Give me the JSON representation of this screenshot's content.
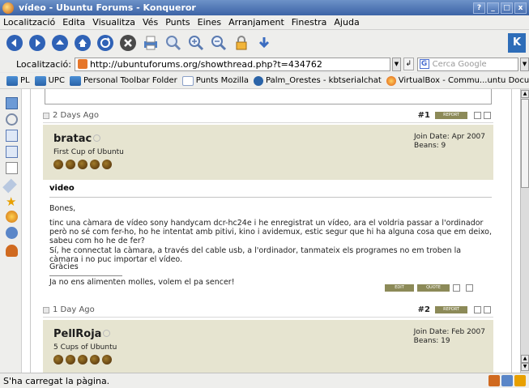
{
  "window": {
    "title": "vídeo - Ubuntu Forums - Konqueror",
    "buttons": [
      "?",
      "_",
      "□",
      "x"
    ]
  },
  "menubar": {
    "items": [
      "Localització",
      "Edita",
      "Visualitza",
      "Vés",
      "Punts",
      "Eines",
      "Arranjament",
      "Finestra",
      "Ajuda"
    ]
  },
  "toolbar": {
    "icons": [
      "back-icon",
      "forward-icon",
      "up-icon",
      "home-icon",
      "reload-icon",
      "stop-icon",
      "print-icon",
      "tools-icon",
      "zoom-in-icon",
      "zoom-out-icon",
      "lock-icon",
      "download-icon"
    ]
  },
  "location": {
    "label": "Localització:",
    "url": "http://ubuntuforums.org/showthread.php?t=434762",
    "search_placeholder": "Cerca Google"
  },
  "bookmarks": {
    "items": [
      "PL",
      "UPC",
      "Personal Toolbar Folder",
      "Punts Mozilla",
      "Palm_Orestes - kbtserialchat",
      "VirtualBox - Commu...untu Documentation"
    ],
    "overflow": "»"
  },
  "posts": [
    {
      "date": "2 Days Ago",
      "number": "#1",
      "report": "REPORT",
      "username": "bratac",
      "user_title": "First Cup of Ubuntu",
      "join_date": "Join Date: Apr 2007",
      "beans": "Beans: 9"
    },
    {
      "date": "1 Day Ago",
      "number": "#2",
      "report": "REPORT",
      "username": "PellRoja",
      "user_title": "5 Cups of Ubuntu",
      "join_date": "Join Date: Feb 2007",
      "beans": "Beans: 19"
    }
  ],
  "post_body": {
    "title": "video",
    "greeting": "Bones,",
    "para1": "tinc una càmara de vídeo sony handycam dcr-hc24e i he enregistrat un vídeo, ara el voldria passar a l'ordinador però no sé com fer-ho, ho he intentat amb pitivi, kino i avidemux, estic segur que hi ha alguna cosa que em deixo, sabeu com ho he de fer?",
    "para2": "Sí, he connectat la càmara, a través del cable usb, a l'ordinador, tanmateix els programes no em troben la càmara i no puc importar el vídeo.",
    "thanks": "Gràcies",
    "signature": "Ja no ens alimenten molles, volem el pa sencer!",
    "btn_edit": "EDIT",
    "btn_quote": "QUOTE"
  },
  "status": {
    "text": "S'ha carregat la pàgina."
  }
}
